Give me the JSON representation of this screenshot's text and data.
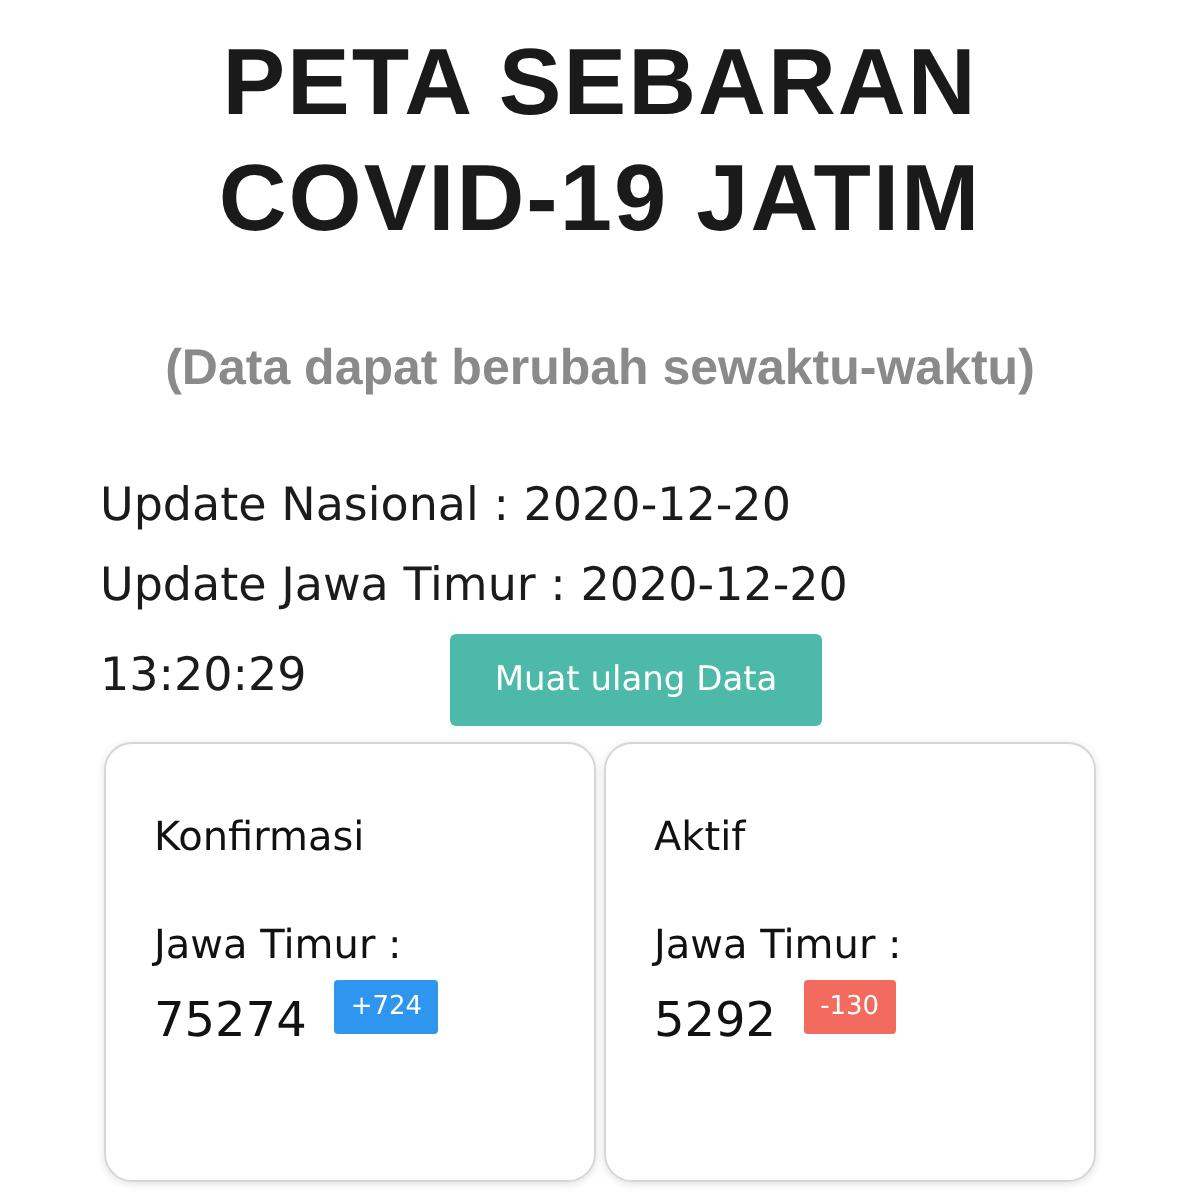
{
  "title": "PETA SEBARAN COVID-19 JATIM",
  "subtitle": "(Data dapat berubah sewaktu-waktu)",
  "updates": [
    "Update Nasional : 2020-12-20",
    "Update Jawa Timur : 2020-12-20"
  ],
  "update_time": "13:20:29",
  "reload_button": "Muat ulang Data",
  "cards": [
    {
      "title": "Konfirmasi",
      "region": "Jawa Timur :",
      "value": "75274",
      "change": "+724",
      "color": "#2f96ef"
    },
    {
      "title": "Aktif",
      "region": "Jawa Timur :",
      "value": "5292",
      "change": "-130",
      "color": "#f26b5e"
    }
  ]
}
